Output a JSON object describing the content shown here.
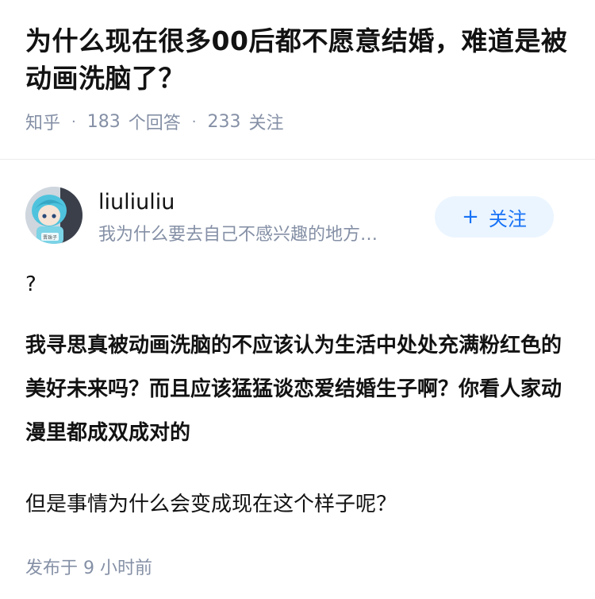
{
  "question": {
    "title": "为什么现在很多00后都不愿意结婚，难道是被动画洗脑了？",
    "source": "知乎",
    "answer_count": "183",
    "answer_label": "个回答",
    "follower_count": "233",
    "follower_label": "关注"
  },
  "author": {
    "name": "liuliuliu",
    "bio": "我为什么要去自己不感兴趣的地方…",
    "avatar_label": "晋珠子",
    "follow_button": "关注",
    "follow_icon": "plus-icon"
  },
  "answer": {
    "paragraphs": [
      "?",
      "我寻思真被动画洗脑的不应该认为生活中处处充满粉红色的美好未来吗？而且应该猛猛谈恋爱结婚生子啊？你看人家动漫里都成双成对的",
      "但是事情为什么会变成现在这个样子呢？"
    ],
    "published": "发布于  9 小时前"
  },
  "colors": {
    "accent": "#1772f6",
    "follow_bg": "#ebf5ff",
    "meta_text": "#8590a6",
    "body_text": "#121212"
  }
}
